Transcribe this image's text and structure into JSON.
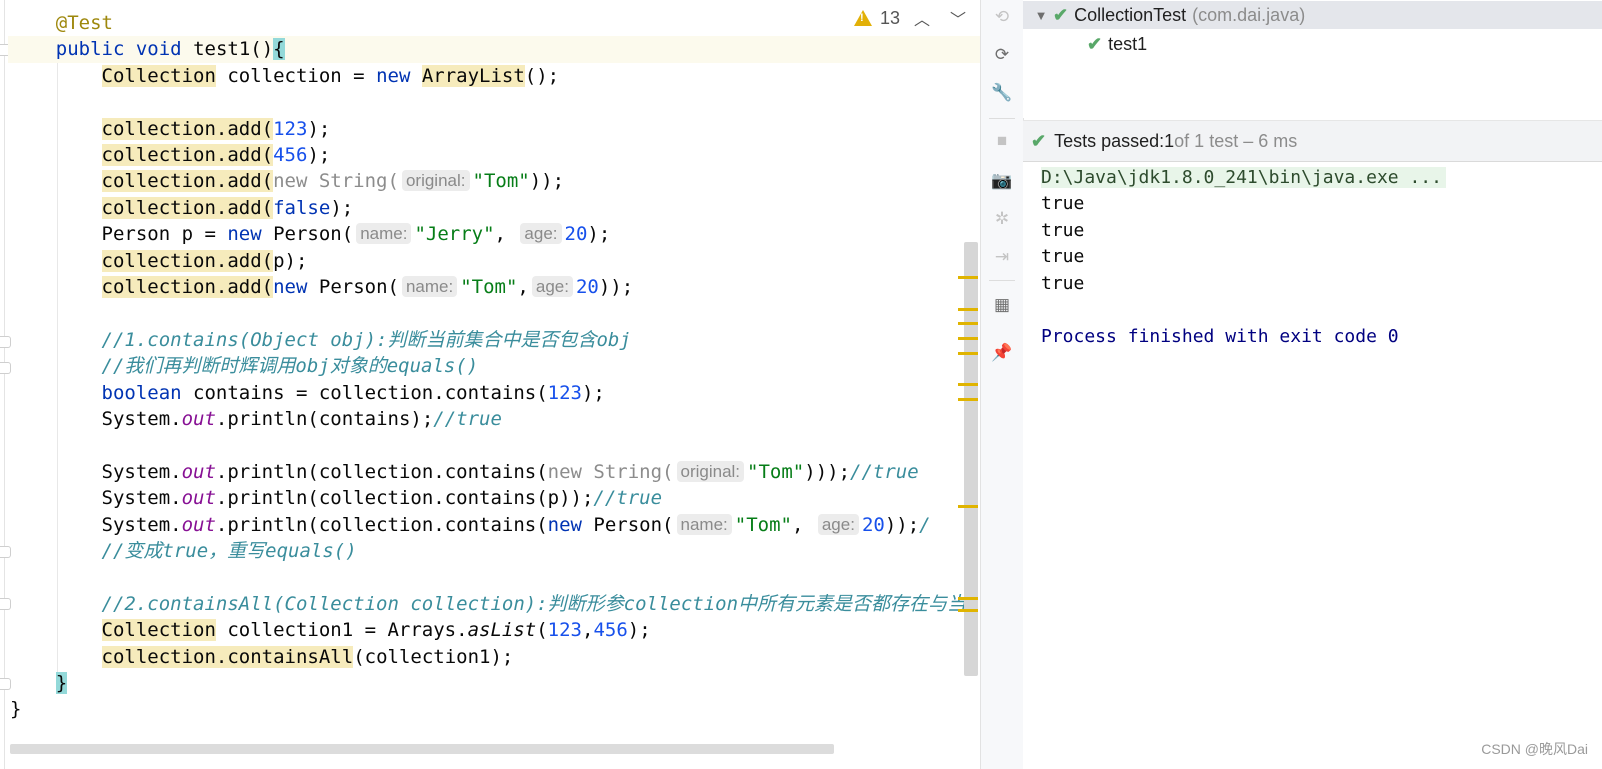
{
  "editor": {
    "inspection": {
      "warning_count": "13",
      "icon": "warning-icon",
      "up": "up-chevron-icon",
      "down": "down-chevron-icon"
    },
    "lines": [
      {
        "segments": [
          {
            "t": "    "
          },
          {
            "t": "@Test",
            "c": "ann"
          }
        ]
      },
      {
        "segments": [
          {
            "t": "    "
          },
          {
            "t": "public",
            "c": "kw"
          },
          {
            "t": " "
          },
          {
            "t": "void",
            "c": "kw"
          },
          {
            "t": " test1()"
          },
          {
            "t": "{",
            "c": "brace-hl"
          }
        ]
      },
      {
        "segments": [
          {
            "t": "        "
          },
          {
            "t": "Collection",
            "c": "hl"
          },
          {
            "t": " collection = "
          },
          {
            "t": "new",
            "c": "kw"
          },
          {
            "t": " "
          },
          {
            "t": "ArrayList",
            "c": "hl"
          },
          {
            "t": "();"
          }
        ]
      },
      {
        "segments": []
      },
      {
        "segments": [
          {
            "t": "        "
          },
          {
            "t": "collection.add(",
            "c": "hl"
          },
          {
            "t": "123",
            "c": "num"
          },
          {
            "t": ");"
          }
        ]
      },
      {
        "segments": [
          {
            "t": "        "
          },
          {
            "t": "collection.add(",
            "c": "hl"
          },
          {
            "t": "456",
            "c": "num"
          },
          {
            "t": ");"
          }
        ]
      },
      {
        "segments": [
          {
            "t": "        "
          },
          {
            "t": "collection.add(",
            "c": "hl"
          },
          {
            "t": "new String(",
            "c": "dim"
          },
          {
            "t": "original:",
            "c": "hint"
          },
          {
            "t": "\"Tom\"",
            "c": "str"
          },
          {
            "t": "));"
          }
        ]
      },
      {
        "segments": [
          {
            "t": "        "
          },
          {
            "t": "collection.add(",
            "c": "hl"
          },
          {
            "t": "false",
            "c": "kw"
          },
          {
            "t": ");"
          }
        ]
      },
      {
        "segments": [
          {
            "t": "        Person p = "
          },
          {
            "t": "new",
            "c": "kw"
          },
          {
            "t": " Person("
          },
          {
            "t": "name:",
            "c": "hint"
          },
          {
            "t": "\"Jerry\"",
            "c": "str"
          },
          {
            "t": ", "
          },
          {
            "t": "age:",
            "c": "hint"
          },
          {
            "t": "20",
            "c": "num"
          },
          {
            "t": ");"
          }
        ]
      },
      {
        "segments": [
          {
            "t": "        "
          },
          {
            "t": "collection.add(",
            "c": "hl"
          },
          {
            "t": "p);"
          }
        ]
      },
      {
        "segments": [
          {
            "t": "        "
          },
          {
            "t": "collection.add(",
            "c": "hl"
          },
          {
            "t": "new",
            "c": "kw"
          },
          {
            "t": " Person("
          },
          {
            "t": "name:",
            "c": "hint"
          },
          {
            "t": "\"Tom\"",
            "c": "str"
          },
          {
            "t": ","
          },
          {
            "t": "age:",
            "c": "hint"
          },
          {
            "t": "20",
            "c": "num"
          },
          {
            "t": "));"
          }
        ]
      },
      {
        "segments": []
      },
      {
        "segments": [
          {
            "t": "        "
          },
          {
            "t": "//1.contains(Object obj):判断当前集合中是否包含obj",
            "c": "cmt2"
          }
        ]
      },
      {
        "segments": [
          {
            "t": "        "
          },
          {
            "t": "//我们再判断时辉调用obj对象的equals()",
            "c": "cmt2"
          }
        ]
      },
      {
        "segments": [
          {
            "t": "        "
          },
          {
            "t": "boolean",
            "c": "kw"
          },
          {
            "t": " contains = collection.contains("
          },
          {
            "t": "123",
            "c": "num"
          },
          {
            "t": ");"
          }
        ]
      },
      {
        "segments": [
          {
            "t": "        System."
          },
          {
            "t": "out",
            "c": "fld"
          },
          {
            "t": ".println(contains);"
          },
          {
            "t": "//true",
            "c": "cmt2"
          }
        ]
      },
      {
        "segments": []
      },
      {
        "segments": [
          {
            "t": "        System."
          },
          {
            "t": "out",
            "c": "fld"
          },
          {
            "t": ".println(collection.contains("
          },
          {
            "t": "new String(",
            "c": "dim"
          },
          {
            "t": "original:",
            "c": "hint"
          },
          {
            "t": "\"Tom\"",
            "c": "str"
          },
          {
            "t": ")));"
          },
          {
            "t": "//true",
            "c": "cmt2"
          }
        ]
      },
      {
        "segments": [
          {
            "t": "        System."
          },
          {
            "t": "out",
            "c": "fld"
          },
          {
            "t": ".println(collection.contains(p));"
          },
          {
            "t": "//true",
            "c": "cmt2"
          }
        ]
      },
      {
        "segments": [
          {
            "t": "        System."
          },
          {
            "t": "out",
            "c": "fld"
          },
          {
            "t": ".println(collection.contains("
          },
          {
            "t": "new",
            "c": "kw"
          },
          {
            "t": " Person("
          },
          {
            "t": "name:",
            "c": "hint"
          },
          {
            "t": "\"Tom\"",
            "c": "str"
          },
          {
            "t": ", "
          },
          {
            "t": "age:",
            "c": "hint"
          },
          {
            "t": "20",
            "c": "num"
          },
          {
            "t": "));"
          },
          {
            "t": "/",
            "c": "cmt2"
          }
        ]
      },
      {
        "segments": [
          {
            "t": "        "
          },
          {
            "t": "//变成true，重写equals()",
            "c": "cmt2"
          }
        ]
      },
      {
        "segments": []
      },
      {
        "segments": [
          {
            "t": "        "
          },
          {
            "t": "//2.containsAll(Collection collection):判断形参collection中所有元素是否都存在与当",
            "c": "cmt2"
          }
        ]
      },
      {
        "segments": [
          {
            "t": "        "
          },
          {
            "t": "Collection",
            "c": "hl"
          },
          {
            "t": " collection1 = Arrays."
          },
          {
            "t": "asList",
            "c": "mth"
          },
          {
            "t": "("
          },
          {
            "t": "123",
            "c": "num"
          },
          {
            "t": ","
          },
          {
            "t": "456",
            "c": "num"
          },
          {
            "t": ");"
          }
        ]
      },
      {
        "segments": [
          {
            "t": "        "
          },
          {
            "t": "collection.containsAll",
            "c": "hl"
          },
          {
            "t": "(collection1);"
          }
        ]
      },
      {
        "segments": [
          {
            "t": "    "
          },
          {
            "t": "}",
            "c": "brace-hl"
          }
        ]
      },
      {
        "segments": [
          {
            "t": "}"
          }
        ]
      }
    ]
  },
  "toolbar": {
    "buttons": [
      {
        "name": "rerun-failed-icon",
        "glyph": "⟲",
        "disabled": true
      },
      {
        "name": "toggle-auto-test-icon",
        "glyph": "⟳",
        "disabled": false
      },
      {
        "name": "settings-wrench-icon",
        "glyph": "🔧",
        "disabled": false
      },
      {
        "name": "stop-icon",
        "glyph": "■",
        "disabled": true
      },
      {
        "name": "dump-threads-camera-icon",
        "glyph": "📷",
        "disabled": true
      },
      {
        "name": "debug-bug-icon",
        "glyph": "✲",
        "disabled": true
      },
      {
        "name": "exit-icon",
        "glyph": "⇥",
        "disabled": true
      },
      {
        "name": "layout-icon",
        "glyph": "▦",
        "disabled": false
      },
      {
        "name": "pin-tab-icon",
        "glyph": "📌",
        "disabled": false
      }
    ]
  },
  "test_tree": {
    "root": {
      "label": "CollectionTest",
      "package": "(com.dai.java)",
      "status": "passed"
    },
    "children": [
      {
        "label": "test1",
        "status": "passed"
      }
    ]
  },
  "status": {
    "prefix": "Tests passed: ",
    "count": "1",
    "rest": " of 1 test – 6 ms"
  },
  "console": {
    "command": "D:\\Java\\jdk1.8.0_241\\bin\\java.exe ...",
    "outputs": [
      "true",
      "true",
      "true",
      "true"
    ],
    "finished": "Process finished with exit code 0"
  },
  "watermark": "CSDN @晚风Dai",
  "colors": {
    "accent_pass": "#59a869",
    "warning": "#e2b007",
    "keyword": "#0033b3",
    "string": "#067d17",
    "number": "#1750eb"
  }
}
